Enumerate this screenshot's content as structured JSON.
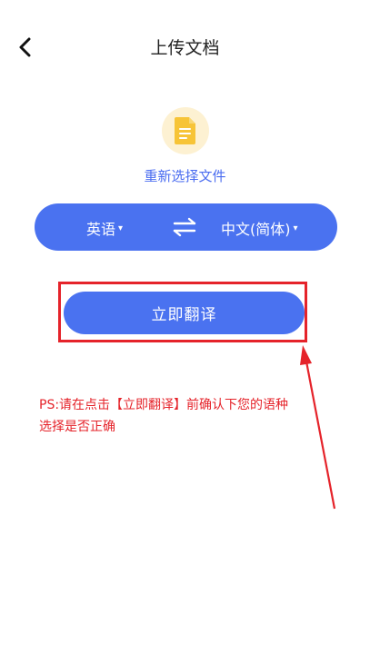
{
  "header": {
    "title": "上传文档",
    "back_icon": "chevron-left-icon"
  },
  "file": {
    "icon": "document-icon",
    "icon_color": "#f7c437",
    "reselect_label": "重新选择文件"
  },
  "language_bar": {
    "source_language": "英语",
    "target_language": "中文(简体)",
    "caret": "▾",
    "swap_icon": "swap-arrows-icon"
  },
  "actions": {
    "translate_label": "立即翻译"
  },
  "annotation": {
    "note_line1": "PS:请在点击【立即翻译】前确认下您的语种",
    "note_line2": "选择是否正确",
    "color": "#e5232a"
  },
  "colors": {
    "accent": "#4a72f0",
    "link": "#4a6cf0",
    "annotation_red": "#e5232a"
  }
}
